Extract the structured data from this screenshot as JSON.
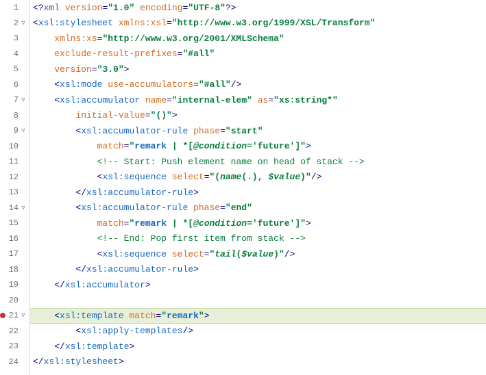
{
  "lines": [
    {
      "n": "1",
      "fold": "",
      "bp": false,
      "hl": false,
      "tokens": [
        {
          "c": "t-punct",
          "t": "<?"
        },
        {
          "c": "t-decl",
          "t": "xml"
        },
        {
          "c": "",
          "t": " "
        },
        {
          "c": "t-attr",
          "t": "version"
        },
        {
          "c": "t-punct",
          "t": "="
        },
        {
          "c": "t-str",
          "t": "\"1.0\""
        },
        {
          "c": "",
          "t": " "
        },
        {
          "c": "t-attr",
          "t": "encoding"
        },
        {
          "c": "t-punct",
          "t": "="
        },
        {
          "c": "t-str",
          "t": "\"UTF-8\""
        },
        {
          "c": "t-punct",
          "t": "?>"
        }
      ]
    },
    {
      "n": "2",
      "fold": "▽",
      "bp": false,
      "hl": false,
      "tokens": [
        {
          "c": "t-punct",
          "t": "<"
        },
        {
          "c": "t-tag",
          "t": "xsl:stylesheet"
        },
        {
          "c": "",
          "t": " "
        },
        {
          "c": "t-attr",
          "t": "xmlns:xsl"
        },
        {
          "c": "t-punct",
          "t": "="
        },
        {
          "c": "t-str",
          "t": "\"http://www.w3.org/1999/XSL/Transform\""
        }
      ]
    },
    {
      "n": "3",
      "fold": "",
      "bp": false,
      "hl": false,
      "tokens": [
        {
          "c": "",
          "t": "    "
        },
        {
          "c": "t-attr",
          "t": "xmlns:xs"
        },
        {
          "c": "t-punct",
          "t": "="
        },
        {
          "c": "t-str",
          "t": "\"http://www.w3.org/2001/XMLSchema\""
        }
      ]
    },
    {
      "n": "4",
      "fold": "",
      "bp": false,
      "hl": false,
      "tokens": [
        {
          "c": "",
          "t": "    "
        },
        {
          "c": "t-attr",
          "t": "exclude-result-prefixes"
        },
        {
          "c": "t-punct",
          "t": "="
        },
        {
          "c": "t-str",
          "t": "\"#all\""
        }
      ]
    },
    {
      "n": "5",
      "fold": "",
      "bp": false,
      "hl": false,
      "tokens": [
        {
          "c": "",
          "t": "    "
        },
        {
          "c": "t-attr",
          "t": "version"
        },
        {
          "c": "t-punct",
          "t": "="
        },
        {
          "c": "t-str",
          "t": "\"3.0\""
        },
        {
          "c": "t-punct",
          "t": ">"
        }
      ]
    },
    {
      "n": "6",
      "fold": "",
      "bp": false,
      "hl": false,
      "tokens": [
        {
          "c": "",
          "t": "    "
        },
        {
          "c": "t-punct",
          "t": "<"
        },
        {
          "c": "t-tag",
          "t": "xsl:mode"
        },
        {
          "c": "",
          "t": " "
        },
        {
          "c": "t-attr",
          "t": "use-accumulators"
        },
        {
          "c": "t-punct",
          "t": "="
        },
        {
          "c": "t-str",
          "t": "\"#all\""
        },
        {
          "c": "t-punct",
          "t": "/>"
        }
      ]
    },
    {
      "n": "7",
      "fold": "▽",
      "bp": false,
      "hl": false,
      "tokens": [
        {
          "c": "",
          "t": "    "
        },
        {
          "c": "t-punct",
          "t": "<"
        },
        {
          "c": "t-tag",
          "t": "xsl:accumulator"
        },
        {
          "c": "",
          "t": " "
        },
        {
          "c": "t-attr",
          "t": "name"
        },
        {
          "c": "t-punct",
          "t": "="
        },
        {
          "c": "t-str",
          "t": "\"internal-elem\""
        },
        {
          "c": "",
          "t": " "
        },
        {
          "c": "t-attr",
          "t": "as"
        },
        {
          "c": "t-punct",
          "t": "="
        },
        {
          "c": "t-str",
          "t": "\"xs:string*\""
        }
      ]
    },
    {
      "n": "8",
      "fold": "",
      "bp": false,
      "hl": false,
      "tokens": [
        {
          "c": "",
          "t": "        "
        },
        {
          "c": "t-attr",
          "t": "initial-value"
        },
        {
          "c": "t-punct",
          "t": "="
        },
        {
          "c": "t-str",
          "t": "\"()\""
        },
        {
          "c": "t-punct",
          "t": ">"
        }
      ]
    },
    {
      "n": "9",
      "fold": "▽",
      "bp": false,
      "hl": false,
      "tokens": [
        {
          "c": "",
          "t": "        "
        },
        {
          "c": "t-punct",
          "t": "<"
        },
        {
          "c": "t-tag",
          "t": "xsl:accumulator-rule"
        },
        {
          "c": "",
          "t": " "
        },
        {
          "c": "t-attr",
          "t": "phase"
        },
        {
          "c": "t-punct",
          "t": "="
        },
        {
          "c": "t-str",
          "t": "\"start\""
        }
      ]
    },
    {
      "n": "10",
      "fold": "",
      "bp": false,
      "hl": false,
      "tokens": [
        {
          "c": "",
          "t": "            "
        },
        {
          "c": "t-attr",
          "t": "match"
        },
        {
          "c": "t-punct",
          "t": "="
        },
        {
          "c": "t-str",
          "t": "\""
        },
        {
          "c": "t-remark",
          "t": "remark"
        },
        {
          "c": "t-str",
          "t": " | *["
        },
        {
          "c": "t-str t-ital",
          "t": "@condition"
        },
        {
          "c": "t-str",
          "t": "='future']\""
        },
        {
          "c": "t-punct",
          "t": ">"
        }
      ]
    },
    {
      "n": "11",
      "fold": "",
      "bp": false,
      "hl": false,
      "tokens": [
        {
          "c": "",
          "t": "            "
        },
        {
          "c": "t-comment",
          "t": "<!-- Start: Push element name on head of stack -->"
        }
      ]
    },
    {
      "n": "12",
      "fold": "",
      "bp": false,
      "hl": false,
      "tokens": [
        {
          "c": "",
          "t": "            "
        },
        {
          "c": "t-punct",
          "t": "<"
        },
        {
          "c": "t-tag",
          "t": "xsl:sequence"
        },
        {
          "c": "",
          "t": " "
        },
        {
          "c": "t-attr",
          "t": "select"
        },
        {
          "c": "t-punct",
          "t": "="
        },
        {
          "c": "t-str",
          "t": "\"("
        },
        {
          "c": "t-str t-ital",
          "t": "name"
        },
        {
          "c": "t-str",
          "t": "(.), "
        },
        {
          "c": "t-str t-ital",
          "t": "$value"
        },
        {
          "c": "t-str",
          "t": ")\""
        },
        {
          "c": "t-punct",
          "t": "/>"
        }
      ]
    },
    {
      "n": "13",
      "fold": "",
      "bp": false,
      "hl": false,
      "tokens": [
        {
          "c": "",
          "t": "        "
        },
        {
          "c": "t-punct",
          "t": "</"
        },
        {
          "c": "t-tag",
          "t": "xsl:accumulator-rule"
        },
        {
          "c": "t-punct",
          "t": ">"
        }
      ]
    },
    {
      "n": "14",
      "fold": "▽",
      "bp": false,
      "hl": false,
      "tokens": [
        {
          "c": "",
          "t": "        "
        },
        {
          "c": "t-punct",
          "t": "<"
        },
        {
          "c": "t-tag",
          "t": "xsl:accumulator-rule"
        },
        {
          "c": "",
          "t": " "
        },
        {
          "c": "t-attr",
          "t": "phase"
        },
        {
          "c": "t-punct",
          "t": "="
        },
        {
          "c": "t-str",
          "t": "\"end\""
        }
      ]
    },
    {
      "n": "15",
      "fold": "",
      "bp": false,
      "hl": false,
      "tokens": [
        {
          "c": "",
          "t": "            "
        },
        {
          "c": "t-attr",
          "t": "match"
        },
        {
          "c": "t-punct",
          "t": "="
        },
        {
          "c": "t-str",
          "t": "\""
        },
        {
          "c": "t-remark",
          "t": "remark"
        },
        {
          "c": "t-str",
          "t": " | *["
        },
        {
          "c": "t-str t-ital",
          "t": "@condition"
        },
        {
          "c": "t-str",
          "t": "='future']\""
        },
        {
          "c": "t-punct",
          "t": ">"
        }
      ]
    },
    {
      "n": "16",
      "fold": "",
      "bp": false,
      "hl": false,
      "tokens": [
        {
          "c": "",
          "t": "            "
        },
        {
          "c": "t-comment",
          "t": "<!-- End: Pop first item from stack -->"
        }
      ]
    },
    {
      "n": "17",
      "fold": "",
      "bp": false,
      "hl": false,
      "tokens": [
        {
          "c": "",
          "t": "            "
        },
        {
          "c": "t-punct",
          "t": "<"
        },
        {
          "c": "t-tag",
          "t": "xsl:sequence"
        },
        {
          "c": "",
          "t": " "
        },
        {
          "c": "t-attr",
          "t": "select"
        },
        {
          "c": "t-punct",
          "t": "="
        },
        {
          "c": "t-str",
          "t": "\""
        },
        {
          "c": "t-str t-ital",
          "t": "tail"
        },
        {
          "c": "t-str",
          "t": "("
        },
        {
          "c": "t-str t-ital",
          "t": "$value"
        },
        {
          "c": "t-str",
          "t": ")\""
        },
        {
          "c": "t-punct",
          "t": "/>"
        }
      ]
    },
    {
      "n": "18",
      "fold": "",
      "bp": false,
      "hl": false,
      "tokens": [
        {
          "c": "",
          "t": "        "
        },
        {
          "c": "t-punct",
          "t": "</"
        },
        {
          "c": "t-tag",
          "t": "xsl:accumulator-rule"
        },
        {
          "c": "t-punct",
          "t": ">"
        }
      ]
    },
    {
      "n": "19",
      "fold": "",
      "bp": false,
      "hl": false,
      "tokens": [
        {
          "c": "",
          "t": "    "
        },
        {
          "c": "t-punct",
          "t": "</"
        },
        {
          "c": "t-tag",
          "t": "xsl:accumulator"
        },
        {
          "c": "t-punct",
          "t": ">"
        }
      ]
    },
    {
      "n": "20",
      "fold": "",
      "bp": false,
      "hl": false,
      "tokens": []
    },
    {
      "n": "21",
      "fold": "▽",
      "bp": true,
      "hl": true,
      "tokens": [
        {
          "c": "",
          "t": "    "
        },
        {
          "c": "t-punct",
          "t": "<"
        },
        {
          "c": "t-tag",
          "t": "xsl:template"
        },
        {
          "c": "",
          "t": " "
        },
        {
          "c": "t-attr",
          "t": "match"
        },
        {
          "c": "t-punct",
          "t": "="
        },
        {
          "c": "t-str",
          "t": "\""
        },
        {
          "c": "t-remark",
          "t": "remark"
        },
        {
          "c": "t-str",
          "t": "\""
        },
        {
          "c": "t-punct",
          "t": ">"
        }
      ]
    },
    {
      "n": "22",
      "fold": "",
      "bp": false,
      "hl": false,
      "tokens": [
        {
          "c": "",
          "t": "        "
        },
        {
          "c": "t-punct",
          "t": "<"
        },
        {
          "c": "t-tag",
          "t": "xsl:apply-templates"
        },
        {
          "c": "t-punct",
          "t": "/>"
        }
      ]
    },
    {
      "n": "23",
      "fold": "",
      "bp": false,
      "hl": false,
      "tokens": [
        {
          "c": "",
          "t": "    "
        },
        {
          "c": "t-punct",
          "t": "</"
        },
        {
          "c": "t-tag",
          "t": "xsl:template"
        },
        {
          "c": "t-punct",
          "t": ">"
        }
      ]
    },
    {
      "n": "24",
      "fold": "",
      "bp": false,
      "hl": false,
      "tokens": [
        {
          "c": "t-punct",
          "t": "</"
        },
        {
          "c": "t-tag",
          "t": "xsl:stylesheet"
        },
        {
          "c": "t-punct",
          "t": ">"
        }
      ]
    }
  ]
}
